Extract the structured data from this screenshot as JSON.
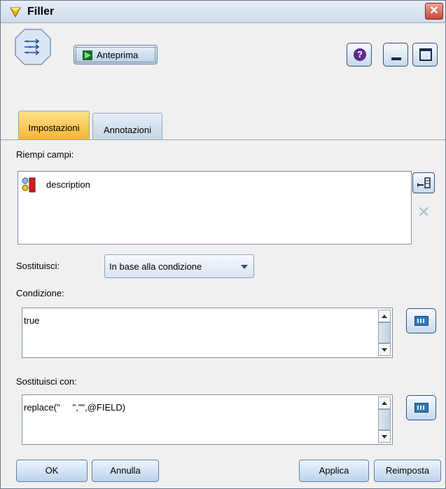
{
  "window": {
    "title": "Filler"
  },
  "toolbar": {
    "preview_label": "Anteprima",
    "help_icon": "question-icon",
    "minimize_icon": "minimize-icon",
    "maximize_icon": "maximize-icon"
  },
  "tabs": [
    {
      "label": "Impostazioni",
      "active": true
    },
    {
      "label": "Annotazioni",
      "active": false
    }
  ],
  "fill_fields": {
    "label": "Riempi campi:",
    "items": [
      {
        "name": "description"
      }
    ]
  },
  "replace": {
    "label": "Sostituisci:",
    "selected": "In base alla condizione"
  },
  "condition": {
    "label": "Condizione:",
    "value": "true"
  },
  "replace_with": {
    "label": "Sostituisci con:",
    "value": "replace(\"     \",\"\",@FIELD)"
  },
  "buttons": {
    "ok": "OK",
    "cancel": "Annulla",
    "apply": "Applica",
    "reset": "Reimposta"
  },
  "colors": {
    "active_tab": "#f5b733",
    "close_button": "#c7483a"
  }
}
